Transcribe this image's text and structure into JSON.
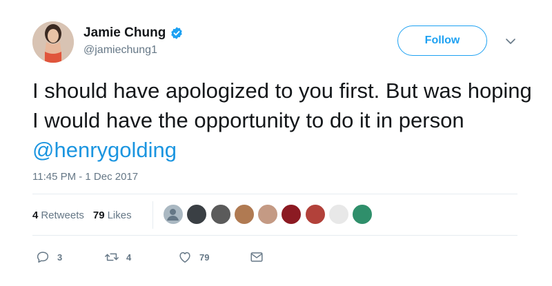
{
  "author": {
    "name": "Jamie Chung",
    "handle": "@jamiechung1",
    "verified": true
  },
  "follow_label": "Follow",
  "tweet": {
    "text": "I should have apologized to you first. But was hoping I would have the opportunity to do it in person ",
    "mention": "@henrygolding"
  },
  "timestamp": "11:45 PM - 1 Dec 2017",
  "stats": {
    "retweets_count": "4",
    "retweets_label": "Retweets",
    "likes_count": "79",
    "likes_label": "Likes"
  },
  "actions": {
    "reply_count": "3",
    "retweet_count": "4",
    "like_count": "79"
  },
  "colors": {
    "accent": "#1da1f2",
    "mention": "#1b95e0",
    "secondary_text": "#657786",
    "divider": "#e6ecf0"
  },
  "liker_avatars": [
    {
      "icon": "default-avatar-icon",
      "color": "#aab8c2"
    },
    {
      "icon": "user-avatar-icon",
      "color": "#3a3f44"
    },
    {
      "icon": "user-avatar-icon",
      "color": "#5b5b5b"
    },
    {
      "icon": "user-avatar-icon",
      "color": "#b07a52"
    },
    {
      "icon": "user-avatar-icon",
      "color": "#c49a84"
    },
    {
      "icon": "user-avatar-icon",
      "color": "#8c1a22"
    },
    {
      "icon": "user-avatar-icon",
      "color": "#b2413a"
    },
    {
      "icon": "user-avatar-icon",
      "color": "#e8e8e8"
    },
    {
      "icon": "user-avatar-icon",
      "color": "#2f8f6b"
    }
  ]
}
